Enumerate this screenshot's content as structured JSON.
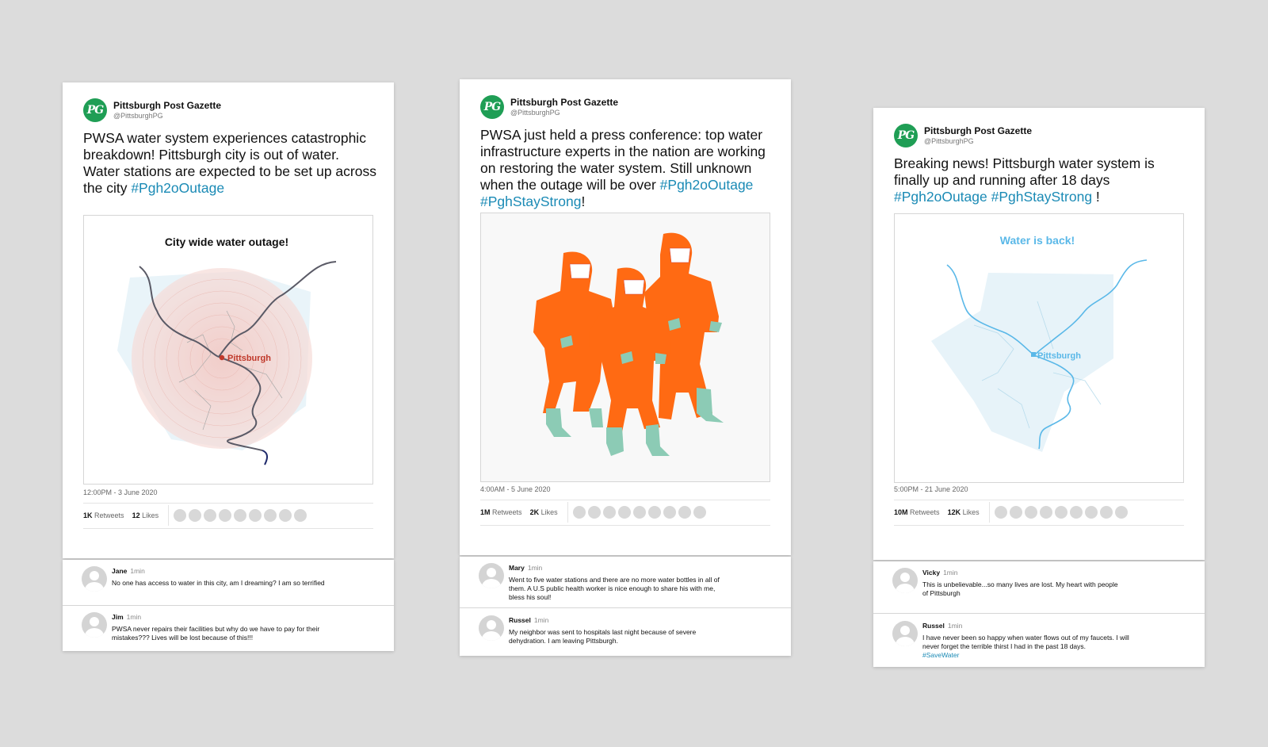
{
  "cards": [
    {
      "author": "Pittsburgh Post Gazette",
      "handle": "@PittsburghPG",
      "logo": "PG",
      "text": "PWSA water system experiences catastrophic breakdown! Pittsburgh city is out of water. Water stations are expected to be set up across the city ",
      "tags": "#Pgh2oOutage",
      "text_tail": "",
      "media_title": "City wide water outage!",
      "media_label": "Pittsburgh",
      "timestamp": "12:00PM - 3 June 2020",
      "retweets": "1K",
      "retweets_label": "Retweets",
      "likes": "12",
      "likes_label": "Likes",
      "comments": [
        {
          "name": "Jane",
          "time": "1min",
          "text": "No one has access to water in this city, am I dreaming? I am so terrified"
        },
        {
          "name": "Jim",
          "time": "1min",
          "text": "PWSA never repairs their facilities but why do we have to pay for their mistakes??? Lives will be lost because of this!!!"
        }
      ]
    },
    {
      "author": "Pittsburgh Post Gazette",
      "handle": "@PittsburghPG",
      "logo": "PG",
      "text": "PWSA just held a press conference: top water infrastructure experts in the nation are working on restoring the water system. Still unknown when the outage will be over ",
      "tags": "#Pgh2oOutage #PghStayStrong",
      "text_tail": "!",
      "timestamp": "4:00AM - 5 June 2020",
      "retweets": "1M",
      "retweets_label": "Retweets",
      "likes": "2K",
      "likes_label": "Likes",
      "comments": [
        {
          "name": "Mary",
          "time": "1min",
          "text": "Went to five water stations and there are no more water bottles in all of them. A U.S public health worker is nice enough to share his with me, bless his soul!"
        },
        {
          "name": "Russel",
          "time": "1min",
          "text": "My neighbor was sent to hospitals last night because of severe dehydration. I am leaving Pittsburgh."
        }
      ]
    },
    {
      "author": "Pittsburgh Post Gazette",
      "handle": "@PittsburghPG",
      "logo": "PG",
      "text": "Breaking news! Pittsburgh water system is finally up and running after 18 days ",
      "tags": "#Pgh2oOutage #PghStayStrong",
      "text_tail": " !",
      "media_title": "Water is back!",
      "media_label": "Pittsburgh",
      "timestamp": "5:00PM - 21 June 2020",
      "retweets": "10M",
      "retweets_label": "Retweets",
      "likes": "12K",
      "likes_label": "Likes",
      "comments": [
        {
          "name": "Vicky",
          "time": "1min",
          "text": "This is unbelievable...so many lives are lost. My heart with people of Pittsburgh"
        },
        {
          "name": "Russel",
          "time": "1min",
          "text": "I have never been so happy when water flows out of my faucets. I will never forget the terrible thirst I had in the past 18 days.",
          "tag": "#SaveWater"
        }
      ]
    }
  ],
  "colors": {
    "brand_green": "#1f9e55",
    "link_blue": "#1a8ab5",
    "hazmat_orange": "#ff6a13",
    "boot_teal": "#8ccbb5",
    "outage_red": "#c0392b",
    "water_blue": "#5ab8e8"
  }
}
